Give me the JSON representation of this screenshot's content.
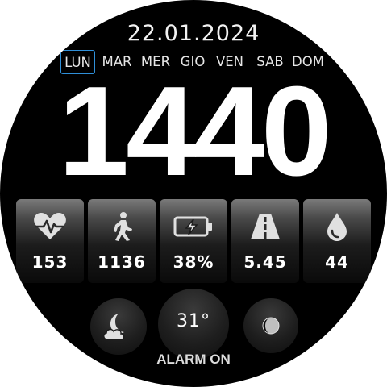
{
  "date": "22.01.2024",
  "weekdays": [
    {
      "label": "LUN",
      "active": true
    },
    {
      "label": "MAR",
      "active": false
    },
    {
      "label": "MER",
      "active": false
    },
    {
      "label": "GIO",
      "active": false
    },
    {
      "label": "VEN",
      "active": false
    },
    {
      "label": "SAB",
      "active": false
    },
    {
      "label": "DOM",
      "active": false
    }
  ],
  "time": "1440",
  "stats": [
    {
      "icon": "heart-rate-icon",
      "value": "153"
    },
    {
      "icon": "steps-icon",
      "value": "1136"
    },
    {
      "icon": "battery-charging-icon",
      "value": "38%"
    },
    {
      "icon": "distance-road-icon",
      "value": "5.45"
    },
    {
      "icon": "water-drop-icon",
      "value": "44"
    }
  ],
  "weather": {
    "icon": "night-cloud-icon",
    "temperature": "31°"
  },
  "moon_phase_icon": "moon-phase-icon",
  "alarm_status": "ALARM ON",
  "colors": {
    "background": "#000000",
    "text": "#ffffff",
    "active_day_border": "#2f8fd8",
    "tile_icon": "#e0e0e0"
  }
}
